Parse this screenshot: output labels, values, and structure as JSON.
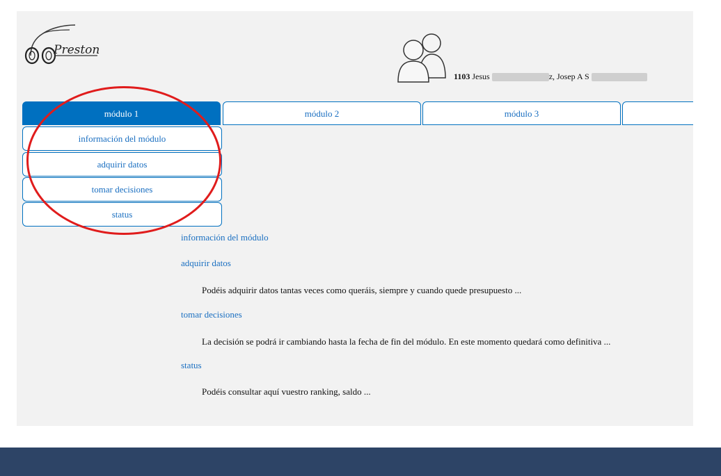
{
  "header": {
    "logo_text": "Preston",
    "user_id": "1103",
    "user_names_a": "Jesus",
    "user_names_b": "z, Josep A S"
  },
  "tabs": [
    {
      "label": "módulo 1",
      "active": true
    },
    {
      "label": "módulo 2",
      "active": false
    },
    {
      "label": "módulo 3",
      "active": false
    },
    {
      "label": "",
      "active": false
    }
  ],
  "submenu": [
    {
      "label": "información del módulo"
    },
    {
      "label": "adquirir datos"
    },
    {
      "label": "tomar decisiones"
    },
    {
      "label": "status"
    }
  ],
  "content": {
    "sections": [
      {
        "title": "información del módulo",
        "desc": ""
      },
      {
        "title": "adquirir datos",
        "desc": "Podéis adquirir datos tantas veces como queráis, siempre y cuando quede presupuesto ..."
      },
      {
        "title": "tomar decisiones",
        "desc": "La decisión se podrá ir cambiando hasta la fecha de fin del módulo. En este momento quedará como definitiva ..."
      },
      {
        "title": "status",
        "desc": "Podéis consultar aquí vuestro ranking, saldo ..."
      }
    ]
  },
  "colors": {
    "accent": "#0070c0",
    "highlight_circle": "#e01c1c",
    "footer": "#2d4466",
    "panel": "#f2f2f2"
  },
  "icons": {
    "logo": "car-icon",
    "users": "users-icon"
  }
}
